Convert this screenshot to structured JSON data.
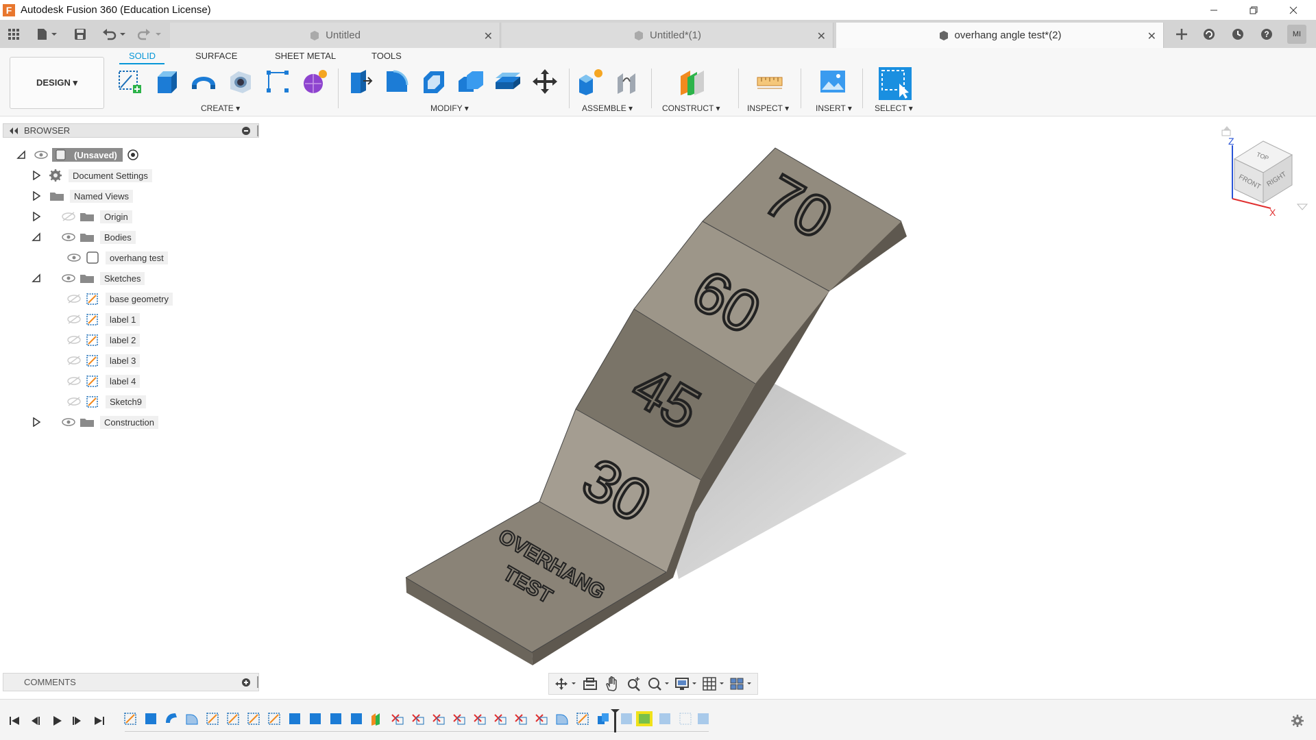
{
  "window": {
    "app_icon_letter": "F",
    "title": "Autodesk Fusion 360 (Education License)"
  },
  "tabs": [
    {
      "label": "Untitled",
      "active": false
    },
    {
      "label": "Untitled*(1)",
      "active": false
    },
    {
      "label": "overhang angle test*(2)",
      "active": true
    }
  ],
  "user": {
    "initials": "MI"
  },
  "workspace": {
    "label": "DESIGN ▾"
  },
  "toolbar_tabs": [
    "SOLID",
    "SURFACE",
    "SHEET METAL",
    "TOOLS"
  ],
  "toolbar_groups": {
    "create": "CREATE ▾",
    "modify": "MODIFY ▾",
    "assemble": "ASSEMBLE ▾",
    "construct": "CONSTRUCT ▾",
    "inspect": "INSPECT ▾",
    "insert": "INSERT ▾",
    "select": "SELECT ▾"
  },
  "browser": {
    "title": "BROWSER",
    "root": "(Unsaved)",
    "items": [
      {
        "label": "Document Settings"
      },
      {
        "label": "Named Views"
      },
      {
        "label": "Origin"
      },
      {
        "label": "Bodies"
      },
      {
        "label": "overhang test"
      },
      {
        "label": "Sketches"
      },
      {
        "label": "base geometry"
      },
      {
        "label": "label 1"
      },
      {
        "label": "label 2"
      },
      {
        "label": "label 3"
      },
      {
        "label": "label 4"
      },
      {
        "label": "Sketch9"
      },
      {
        "label": "Construction"
      }
    ]
  },
  "model": {
    "labels": [
      "70",
      "60",
      "45",
      "30"
    ],
    "base_text_line1": "OVERHANG",
    "base_text_line2": "TEST"
  },
  "viewcube": {
    "top": "TOP",
    "front": "FRONT",
    "right": "RIGHT",
    "axis_z": "Z",
    "axis_x": "X"
  },
  "comments": {
    "title": "COMMENTS"
  },
  "colors": {
    "accent": "#0696d7",
    "model_face": "#8a8377",
    "model_side": "#5e584f"
  }
}
